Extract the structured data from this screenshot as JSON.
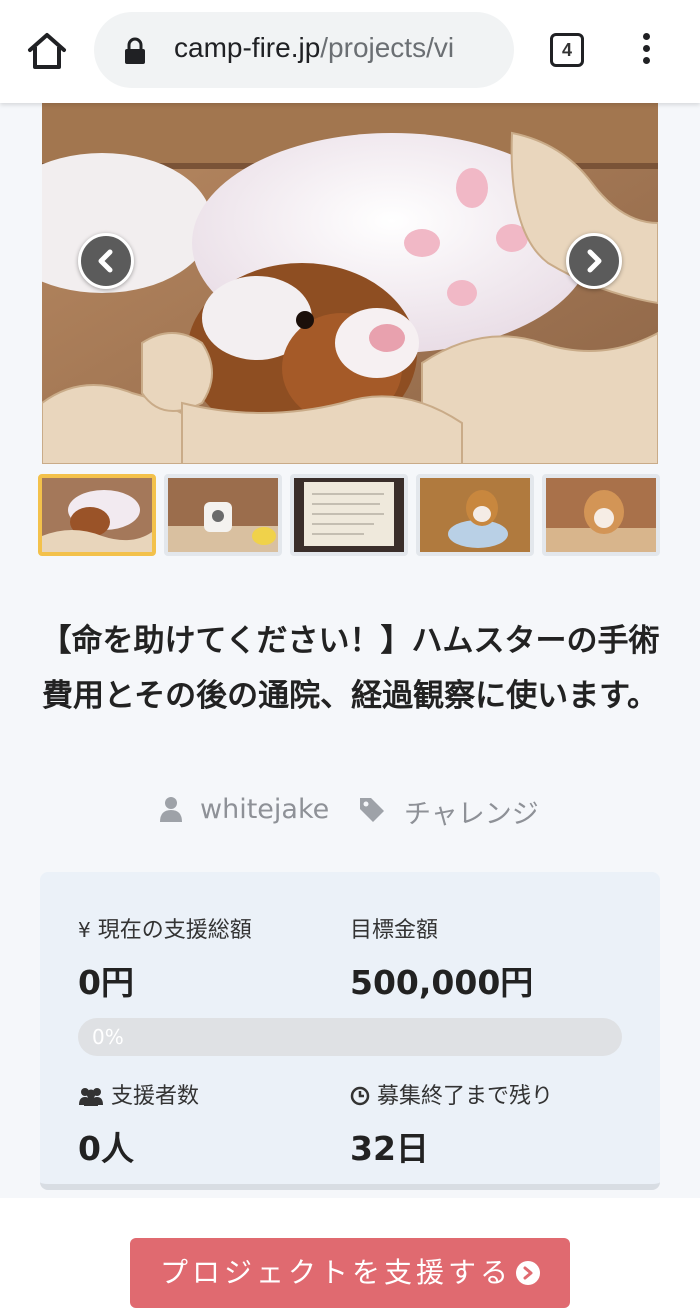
{
  "browser": {
    "url_domain": "camp-fire.jp",
    "url_path": "/projects/vi",
    "tab_count": "4"
  },
  "project": {
    "title": "【命を助けてください！】ハムスターの手術費用とその後の通院、経過観察に使います。",
    "owner": "whitejake",
    "category": "チャレンジ"
  },
  "stats": {
    "current_label": "現在の支援総額",
    "current_value": "0円",
    "goal_label": "目標金額",
    "goal_value": "500,000円",
    "progress_percent": 0,
    "progress_text": "0%",
    "backers_label": "支援者数",
    "backers_value": "0人",
    "remaining_label": "募集終了まで残り",
    "remaining_value": "32日"
  },
  "gallery": {
    "thumbnail_count": 5,
    "active_index": 0
  },
  "cta": {
    "label": "プロジェクトを支援する"
  },
  "colors": {
    "accent": "#e06a70",
    "active_thumb_border": "#f3c14b",
    "stats_bg": "#ebf1f8"
  }
}
